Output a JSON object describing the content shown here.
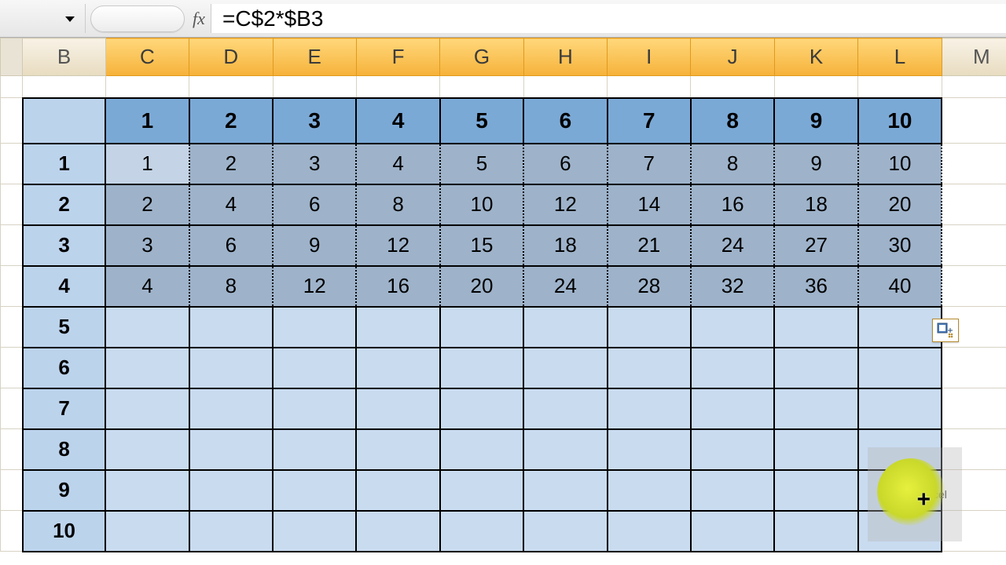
{
  "formula_bar": {
    "fx_label": "fx",
    "formula": "=C$2*$B3"
  },
  "column_headers": [
    "B",
    "C",
    "D",
    "E",
    "F",
    "G",
    "H",
    "I",
    "J",
    "K",
    "L",
    "M"
  ],
  "selected_cols": [
    "C",
    "D",
    "E",
    "F",
    "G",
    "H",
    "I",
    "J",
    "K",
    "L"
  ],
  "table": {
    "col_nums": [
      1,
      2,
      3,
      4,
      5,
      6,
      7,
      8,
      9,
      10
    ],
    "row_nums": [
      1,
      2,
      3,
      4,
      5,
      6,
      7,
      8,
      9,
      10
    ],
    "data": [
      [
        1,
        2,
        3,
        4,
        5,
        6,
        7,
        8,
        9,
        10
      ],
      [
        2,
        4,
        6,
        8,
        10,
        12,
        14,
        16,
        18,
        20
      ],
      [
        3,
        6,
        9,
        12,
        15,
        18,
        21,
        24,
        27,
        30
      ],
      [
        4,
        8,
        12,
        16,
        20,
        24,
        28,
        32,
        36,
        40
      ]
    ]
  },
  "icons": {
    "paste_options": "paste-options-icon",
    "dropdown": "chevron-down-icon"
  },
  "watermark": "Vídeos   Excel",
  "cursor": "+"
}
